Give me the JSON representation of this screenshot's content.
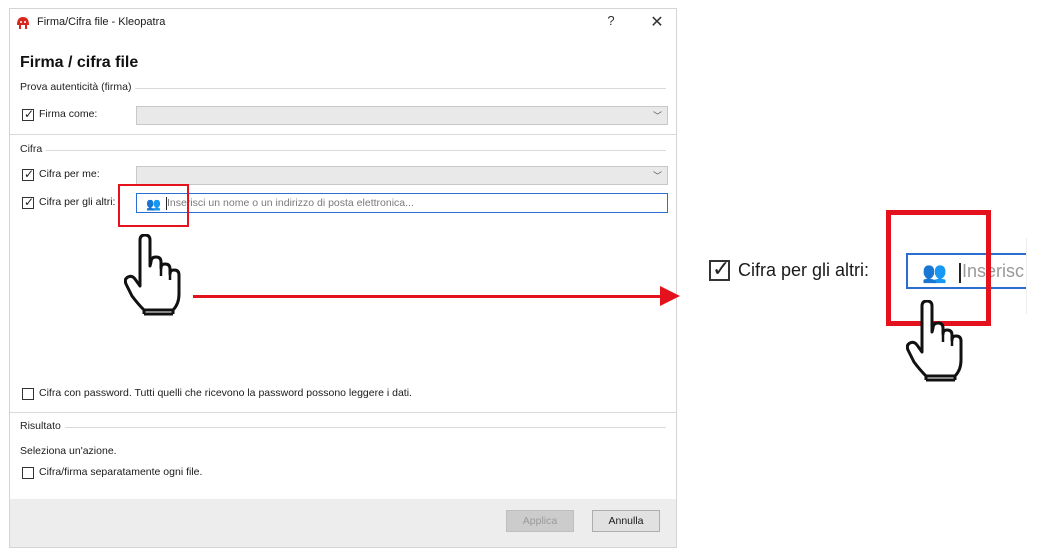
{
  "window": {
    "title": "Firma/Cifra file - Kleopatra",
    "help": "?",
    "close": "✕"
  },
  "heading": "Firma / cifra file",
  "sign_section": {
    "label": "Prova autenticità (firma)",
    "sign_as_label": "Firma come:",
    "sign_as_checked": true,
    "sign_as_value": ""
  },
  "encrypt_section": {
    "label": "Cifra",
    "for_me_label": "Cifra per me:",
    "for_me_checked": true,
    "for_others_label": "Cifra per gli altri:",
    "for_others_checked": true,
    "recipient_placeholder": "Inserisci un nome o un indirizzo di posta elettronica...",
    "recipient_icon": "add-contact-icon",
    "password_label": "Cifra con password. Tutti quelli che ricevono la password possono leggere i dati.",
    "password_checked": false
  },
  "result_section": {
    "label": "Risultato",
    "hint": "Seleziona un'azione.",
    "separate_label": "Cifra/firma separatamente ogni file.",
    "separate_checked": false
  },
  "buttons": {
    "apply": "Applica",
    "cancel": "Annulla"
  },
  "zoom": {
    "label": "Cifra per gli altri:",
    "field_text": "Inserisc"
  },
  "colors": {
    "highlight": "#e3121c",
    "focus_border": "#2a6fcf"
  }
}
